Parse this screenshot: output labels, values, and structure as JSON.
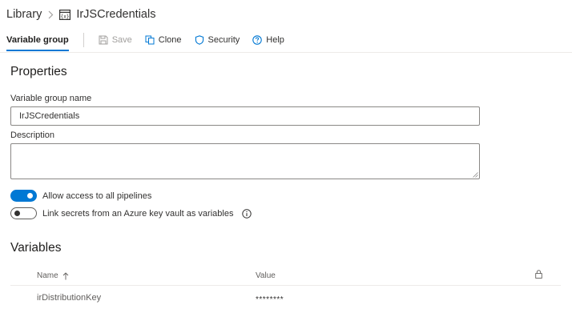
{
  "breadcrumb": {
    "root": "Library",
    "current": "IrJSCredentials"
  },
  "toolbar": {
    "tab": "Variable group",
    "save": "Save",
    "clone": "Clone",
    "security": "Security",
    "help": "Help"
  },
  "properties": {
    "heading": "Properties",
    "name_label": "Variable group name",
    "name_value": "IrJSCredentials",
    "description_label": "Description",
    "description_value": ""
  },
  "toggles": {
    "allow_access": {
      "label": "Allow access to all pipelines",
      "on": true
    },
    "link_secrets": {
      "label": "Link secrets from an Azure key vault as variables",
      "on": false
    }
  },
  "variables": {
    "heading": "Variables",
    "columns": {
      "name": "Name",
      "value": "Value"
    },
    "rows": [
      {
        "name": "irDistributionKey",
        "value": "********"
      }
    ]
  },
  "colors": {
    "accent": "#0078d4",
    "text": "#323130",
    "border": "#8a8886"
  },
  "icons": {
    "library_icon": "variable-group-icon",
    "save": "floppy-disk-icon",
    "clone": "clone-icon",
    "security": "shield-icon",
    "help": "question-circle-icon",
    "info": "info-icon",
    "sort": "arrow-up-icon",
    "lock": "lock-icon"
  }
}
